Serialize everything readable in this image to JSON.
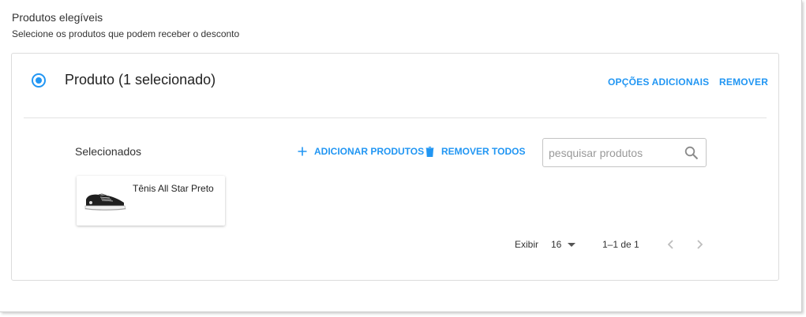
{
  "section": {
    "title": "Produtos elegíveis",
    "subtitle": "Selecione os produtos que podem receber o desconto"
  },
  "option": {
    "heading": "Produto (1 selecionado)",
    "more_options": "OPÇÕES ADICIONAIS",
    "remove": "REMOVER"
  },
  "selected": {
    "label": "Selecionados",
    "add_products": "ADICIONAR PRODUTOS",
    "remove_all": "REMOVER TODOS",
    "search_placeholder": "pesquisar produtos",
    "products": [
      {
        "name": "Tênis All Star Preto",
        "image": "sneaker-image"
      }
    ]
  },
  "pagination": {
    "show_label": "Exibir",
    "page_size": "16",
    "range": "1–1 de 1"
  },
  "colors": {
    "accent": "#2196f3",
    "disabled_icon": "#bdbdbd"
  }
}
